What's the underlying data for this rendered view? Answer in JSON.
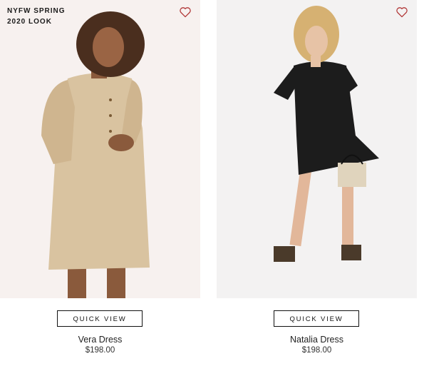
{
  "products": [
    {
      "badge_line1": "NYFW SPRING",
      "badge_line2": "2020 LOOK",
      "image_icon": "model-photo-beige-dress",
      "quick_view_label": "QUICK VIEW",
      "name": "Vera Dress",
      "price": "$198.00",
      "wishlist_icon": "heart-icon"
    },
    {
      "image_icon": "model-photo-black-dress",
      "quick_view_label": "QUICK VIEW",
      "name": "Natalia Dress",
      "price": "$198.00",
      "wishlist_icon": "heart-icon"
    }
  ],
  "colors": {
    "heart": "#b23a3a",
    "beige_dress": "#d9c3a0",
    "black_dress": "#1c1c1c"
  }
}
